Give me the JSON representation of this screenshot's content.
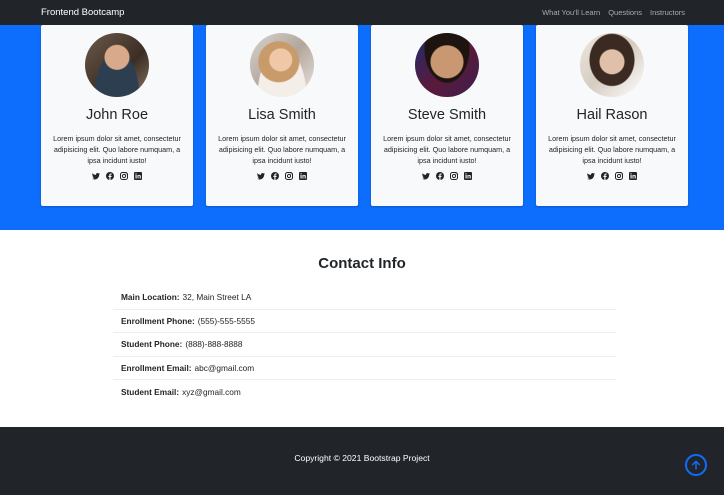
{
  "navbar": {
    "brand": "Frontend Bootcamp",
    "links": [
      "What You'll Learn",
      "Questions",
      "Instructors"
    ]
  },
  "instructors": [
    {
      "name": "John Roe",
      "bio": "Lorem ipsum dolor sit amet, consectetur adipisicing elit. Quo labore numquam, a ipsa incidunt iusto!"
    },
    {
      "name": "Lisa Smith",
      "bio": "Lorem ipsum dolor sit amet, consectetur adipisicing elit. Quo labore numquam, a ipsa incidunt iusto!"
    },
    {
      "name": "Steve Smith",
      "bio": "Lorem ipsum dolor sit amet, consectetur adipisicing elit. Quo labore numquam, a ipsa incidunt iusto!"
    },
    {
      "name": "Hail Rason",
      "bio": "Lorem ipsum dolor sit amet, consectetur adipisicing elit. Quo labore numquam, a ipsa incidunt iusto!"
    }
  ],
  "social_icons": [
    "twitter-icon",
    "facebook-icon",
    "instagram-icon",
    "linkedin-icon"
  ],
  "contact": {
    "title": "Contact Info",
    "rows": [
      {
        "label": "Main Location:",
        "value": "32, Main Street LA"
      },
      {
        "label": "Enrollment Phone:",
        "value": "(555)-555-5555"
      },
      {
        "label": "Student Phone:",
        "value": "(888)-888-8888"
      },
      {
        "label": "Enrollment Email:",
        "value": "abc@gmail.com"
      },
      {
        "label": "Student Email:",
        "value": "xyz@gmail.com"
      }
    ]
  },
  "footer": {
    "copyright": "Copyright © 2021 Bootstrap Project",
    "scroll_icon": "arrow-up-circle-icon"
  },
  "colors": {
    "primary": "#0d6efd",
    "dark": "#212529",
    "card_bg": "#f8f9fa"
  }
}
